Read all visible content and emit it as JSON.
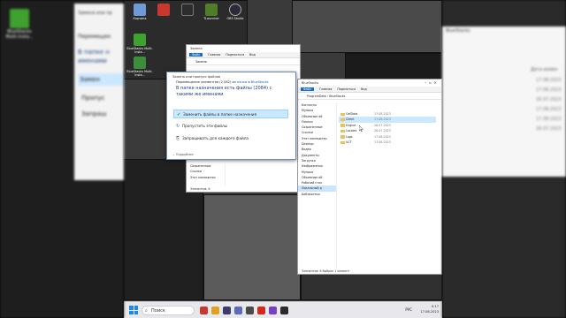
{
  "desktop_icons": [
    {
      "label": "Корзина",
      "color": "#6e9ad6"
    },
    {
      "label": "",
      "color": "#c7392f"
    },
    {
      "label": "",
      "color": "#2d2d2d"
    },
    {
      "label": "TLauncher",
      "color": "#4f7d2a"
    },
    {
      "label": "OBS Studio",
      "color": "#2a2a3a"
    },
    {
      "label": "BlueStacks Multi-Insta...",
      "color": "#3fa12f"
    },
    {
      "label": "BlueStacks Multi-Insta...",
      "color": "#3b8f3b"
    }
  ],
  "behind_dialog_fragment": {
    "title": "Замена или пр",
    "line1": "Перемещен",
    "line2": "В папке н",
    "line3": "именами",
    "opt1": "Замен",
    "opt2": "Пропус",
    "opt3": "Запраш"
  },
  "bluestacks_fragment": {
    "title": "BlueStacks",
    "col": "Дата измен",
    "dates": [
      "17.08.2023",
      "17.08.2023",
      "26.07.2023",
      "17.08.2023",
      "17.08.2023",
      "26.07.2023"
    ]
  },
  "explorer_back": {
    "title": "Замена",
    "ribbon": [
      "Файл",
      "Главная",
      "Поделиться",
      "Вид"
    ],
    "address": "Замена",
    "nav": [
      "Сохраненные",
      "Ссылки",
      "Этот компьютер"
    ],
    "status": "Элементов: 6"
  },
  "explorer_front": {
    "title": "BlueStacks",
    "ribbon": [
      "Файл",
      "Главная",
      "Поделиться",
      "Вид"
    ],
    "address": "ProgramData › BlueStacks",
    "nav": [
      "Контакты",
      "Музыка",
      "Объемные об",
      "Поиски",
      "Сохраненные",
      "Ссылки",
      "Этот компьютер",
      "Desktop",
      "Видео",
      "Документы",
      "Загрузки",
      "Изображения",
      "Музыка",
      "Объемные об",
      "Рабочий стол",
      "Локальный д",
      "Библиотеки"
    ],
    "nav_selected": 15,
    "files": [
      {
        "name": "CefData",
        "date": "17.08.2023"
      },
      {
        "name": "Client",
        "date": "17.08.2023"
      },
      {
        "name": "Engine",
        "date": "26.07.2023"
      },
      {
        "name": "Locales",
        "date": "26.07.2023"
      },
      {
        "name": "Logs",
        "date": "17.08.2023"
      },
      {
        "name": "UCT",
        "date": "17.08.2023"
      }
    ],
    "selected_file": 1,
    "status": "Элементов: 6    Выбран 1 элемент"
  },
  "dialog": {
    "title": "Замена или пропуск файлов",
    "subtitle_prefix": "Перемещение элементов (2 082) из",
    "subtitle_src": "папки",
    "subtitle_mid": "в",
    "subtitle_dst": "BlueStacks",
    "question": "В папке назначения есть файлы (2084) с такими же именами",
    "options": [
      {
        "icon": "✔",
        "label": "Заменить файлы в папке назначения",
        "color": "#1f9d55"
      },
      {
        "icon": "↻",
        "label": "Пропустить эти файлы",
        "color": "#1a5fb4"
      },
      {
        "icon": "⎘",
        "label": "Запрашивать для каждого файла",
        "color": "#555555"
      }
    ],
    "more": "Подробнее"
  },
  "taskbar": {
    "search_placeholder": "Поиск",
    "apps": [
      "#c7392f",
      "#e0a020",
      "#3b3b6d",
      "#5c6bc0",
      "#4a4a4a",
      "#d7261e",
      "#7a3fbf",
      "#2a2a2a"
    ],
    "lang": "РУС",
    "time": "0:17",
    "date": "17.08.2023"
  },
  "colors": {
    "accent": "#1a6dc0",
    "highlight": "#cce8ff",
    "taskbar": "#e8e8ec"
  }
}
